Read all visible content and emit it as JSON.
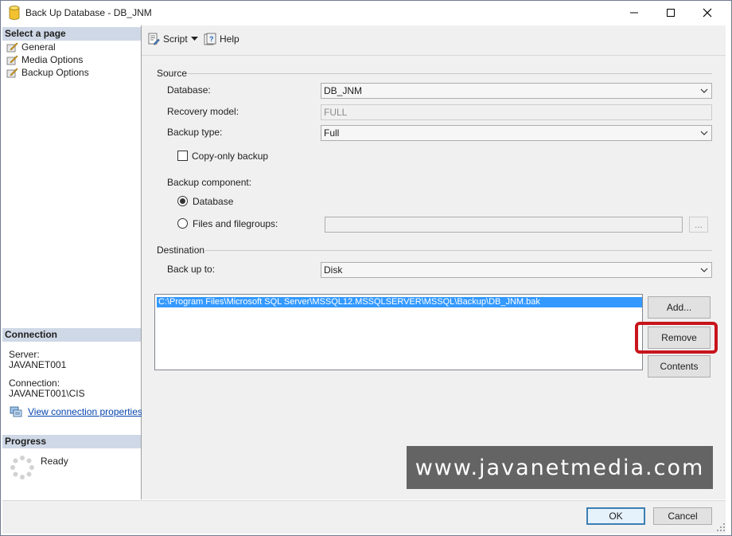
{
  "window": {
    "title": "Back Up Database - DB_JNM",
    "icon": "database-icon"
  },
  "left_pane": {
    "select_page_heading": "Select a page",
    "pages": [
      {
        "label": "General",
        "icon": "page-icon"
      },
      {
        "label": "Media Options",
        "icon": "page-icon"
      },
      {
        "label": "Backup Options",
        "icon": "page-icon"
      }
    ],
    "connection_heading": "Connection",
    "server_label": "Server:",
    "server_value": "JAVANET001",
    "connection_label": "Connection:",
    "connection_value": "JAVANET001\\CIS",
    "view_connection_link": "View connection properties",
    "progress_heading": "Progress",
    "progress_status": "Ready"
  },
  "toolbar": {
    "script_label": "Script",
    "help_label": "Help"
  },
  "source": {
    "group_label": "Source",
    "database_label": "Database:",
    "database_value": "DB_JNM",
    "recovery_label": "Recovery model:",
    "recovery_value": "FULL",
    "backup_type_label": "Backup type:",
    "backup_type_value": "Full",
    "copy_only_label": "Copy-only backup",
    "copy_only_checked": false,
    "component_label": "Backup component:",
    "component_database_label": "Database",
    "component_files_label": "Files and filegroups:",
    "component_selected": "Database",
    "browse_label": "..."
  },
  "destination": {
    "group_label": "Destination",
    "back_up_to_label": "Back up to:",
    "back_up_to_value": "Disk",
    "paths": [
      "C:\\Program Files\\Microsoft SQL Server\\MSSQL12.MSSQLSERVER\\MSSQL\\Backup\\DB_JNM.bak"
    ],
    "add_label": "Add...",
    "remove_label": "Remove",
    "contents_label": "Contents"
  },
  "watermark": "www.javanetmedia.com",
  "footer": {
    "ok_label": "OK",
    "cancel_label": "Cancel"
  },
  "colors": {
    "highlight_border": "#c8141c",
    "selection": "#3399ff",
    "section_header": "#cfd8e6",
    "watermark_bg": "#646464"
  }
}
